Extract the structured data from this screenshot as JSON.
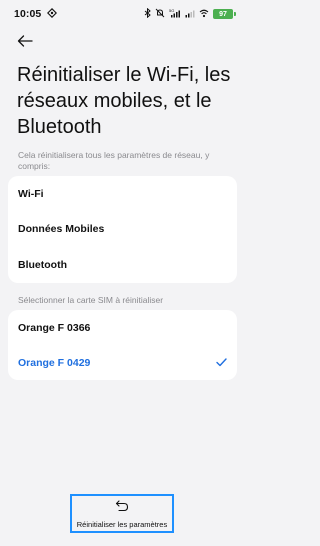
{
  "status_bar": {
    "time": "10:05",
    "battery": "97",
    "network_label": "5G",
    "icons": [
      "vpn-icon",
      "bluetooth-icon",
      "mute-icon",
      "signal-icon",
      "signal-icon",
      "wifi-icon",
      "battery-icon"
    ]
  },
  "header": {
    "back_icon": "arrow-left-icon",
    "title": "Réinitialiser le Wi-Fi, les réseaux mobiles, et le Bluetooth"
  },
  "network_section": {
    "description": "Cela réinitialisera tous les paramètres de réseau, y compris:",
    "items": [
      {
        "label": "Wi-Fi"
      },
      {
        "label": "Données Mobiles"
      },
      {
        "label": "Bluetooth"
      }
    ]
  },
  "sim_section": {
    "label": "Sélectionner la carte SIM à réinitialiser",
    "options": [
      {
        "label": "Orange F 0366",
        "selected": false
      },
      {
        "label": "Orange F 0429",
        "selected": true
      }
    ]
  },
  "footer": {
    "reset_label": "Réinitialiser les paramètres",
    "reset_icon": "undo-icon"
  },
  "colors": {
    "accent": "#1f6fdf",
    "background": "#f3f3f5",
    "card": "#ffffff",
    "muted_text": "#8a8a8e",
    "battery": "#4caf50",
    "highlight_border": "#1e90ff"
  }
}
